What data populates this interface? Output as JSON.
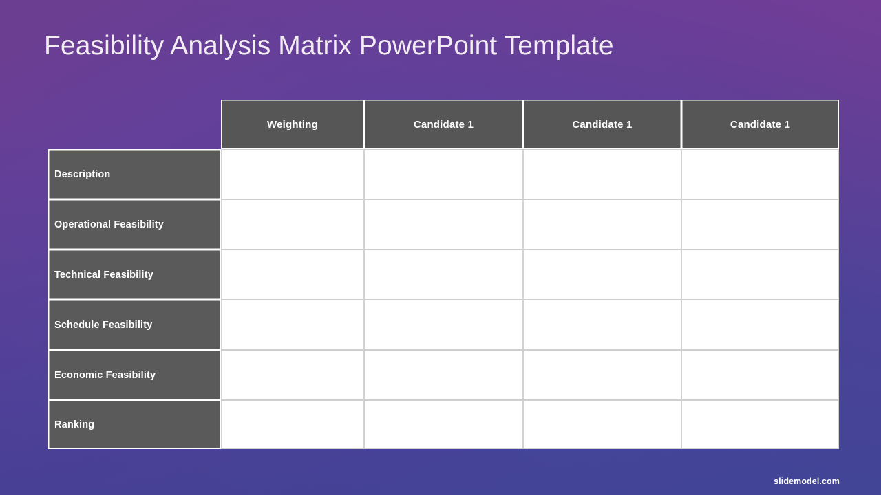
{
  "slide": {
    "title": "Feasibility Analysis Matrix PowerPoint Template",
    "brand": "slidemodel.com",
    "background": {
      "top_right_color": "#6b3e92",
      "bottom_left_color": "#41448f"
    },
    "colors": {
      "header_cell": "#565656",
      "label_cell": "#5a5a5a",
      "data_cell": "#ffffff",
      "cell_border": "#ffffff",
      "data_cell_border": "#d0d0d0",
      "title_text": "#f3ecf4",
      "header_text": "#ffffff"
    }
  },
  "matrix": {
    "corner_label": "",
    "column_headers": [
      "Weighting",
      "Candidate 1",
      "Candidate 1",
      "Candidate 1"
    ],
    "rows": [
      {
        "label": "Description",
        "cells": [
          "",
          "",
          "",
          ""
        ]
      },
      {
        "label": "Operational Feasibility",
        "cells": [
          "",
          "",
          "",
          ""
        ]
      },
      {
        "label": "Technical Feasibility",
        "cells": [
          "",
          "",
          "",
          ""
        ]
      },
      {
        "label": "Schedule Feasibility",
        "cells": [
          "",
          "",
          "",
          ""
        ]
      },
      {
        "label": "Economic Feasibility",
        "cells": [
          "",
          "",
          "",
          ""
        ]
      },
      {
        "label": "Ranking",
        "cells": [
          "",
          "",
          "",
          ""
        ]
      }
    ]
  }
}
